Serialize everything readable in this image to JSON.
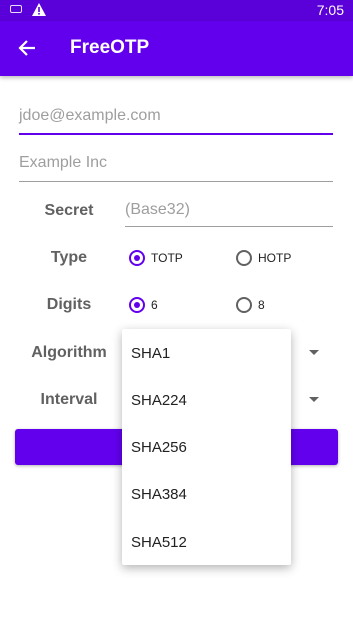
{
  "status_bar": {
    "time": "7:05",
    "icons": [
      "keyboard-icon",
      "warning-icon"
    ]
  },
  "app_bar": {
    "title": "FreeOTP",
    "back_icon": "arrow-back-icon"
  },
  "form": {
    "issuer_placeholder": "jdoe@example.com",
    "label_placeholder": "Example Inc",
    "secret_label": "Secret",
    "secret_placeholder": "(Base32)",
    "type_label": "Type",
    "type_options": [
      "TOTP",
      "HOTP"
    ],
    "type_selected": "TOTP",
    "digits_label": "Digits",
    "digits_options": [
      "6",
      "8"
    ],
    "digits_selected": "6",
    "algorithm_label": "Algorithm",
    "interval_label": "Interval"
  },
  "algorithm_dropdown": {
    "options": [
      "SHA1",
      "SHA224",
      "SHA256",
      "SHA384",
      "SHA512"
    ]
  },
  "colors": {
    "primary": "#6200ee",
    "status_bar": "#5a00d8"
  }
}
